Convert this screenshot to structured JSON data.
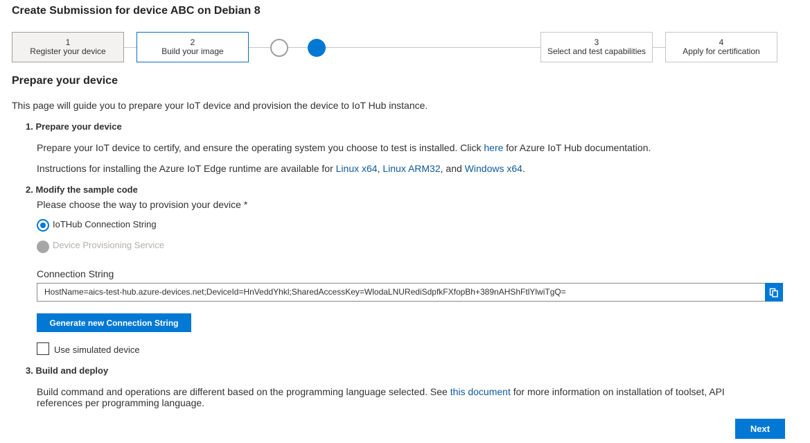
{
  "page": {
    "title": "Create Submission for device ABC on Debian 8"
  },
  "stepper": {
    "steps": [
      {
        "number": "1",
        "label": "Register your device",
        "state": "completed"
      },
      {
        "number": "2",
        "label": "Build your image",
        "state": "active"
      },
      {
        "number": "3",
        "label": "Select and test capabilities",
        "state": "pending"
      },
      {
        "number": "4",
        "label": "Apply for certification",
        "state": "pending"
      }
    ],
    "substeps": [
      {
        "state": "empty"
      },
      {
        "state": "filled"
      }
    ]
  },
  "main": {
    "heading": "Prepare your device",
    "intro": "This page will guide you to prepare your IoT device and provision the device to IoT Hub instance.",
    "section1": {
      "title": "1. Prepare your device",
      "line1_prefix": "Prepare your IoT device to certify, and ensure the operating system you choose to test is installed. Click ",
      "line1_link": "here",
      "line1_suffix": " for Azure IoT Hub documentation.",
      "line2_prefix": "Instructions for installing the Azure IoT Edge runtime are available for ",
      "link_linux_x64": "Linux x64",
      "sep1": ", ",
      "link_linux_arm32": "Linux ARM32",
      "sep2": ", and ",
      "link_windows_x64": "Windows x64",
      "line2_suffix": "."
    },
    "section2": {
      "title": "2. Modify the sample code",
      "prompt": "Please choose the way to provision your device *",
      "options": [
        {
          "label": "IoTHub Connection String",
          "selected": true,
          "disabled": false
        },
        {
          "label": "Device Provisioning Service",
          "selected": false,
          "disabled": true
        }
      ],
      "connection_label": "Connection String",
      "connection_value": "HostName=aics-test-hub.azure-devices.net;DeviceId=HnVeddYhkl;SharedAccessKey=WlodaLNURediSdpfkFXfopBh+389nAHShFtlYlwiTgQ=",
      "generate_label": "Generate new Connection String",
      "simulated_label": "Use simulated device"
    },
    "section3": {
      "title": "3. Build and deploy",
      "text_prefix": "Build command and operations are different based on the programming language selected. See ",
      "link": "this document",
      "text_suffix": " for more information on installation of toolset, API",
      "text_line2": "references per programming language."
    }
  },
  "footer": {
    "next_label": "Next"
  },
  "colors": {
    "accent": "#0078d4",
    "link": "#0f5a9c",
    "text": "#323130",
    "border": "#c8c6c4"
  }
}
